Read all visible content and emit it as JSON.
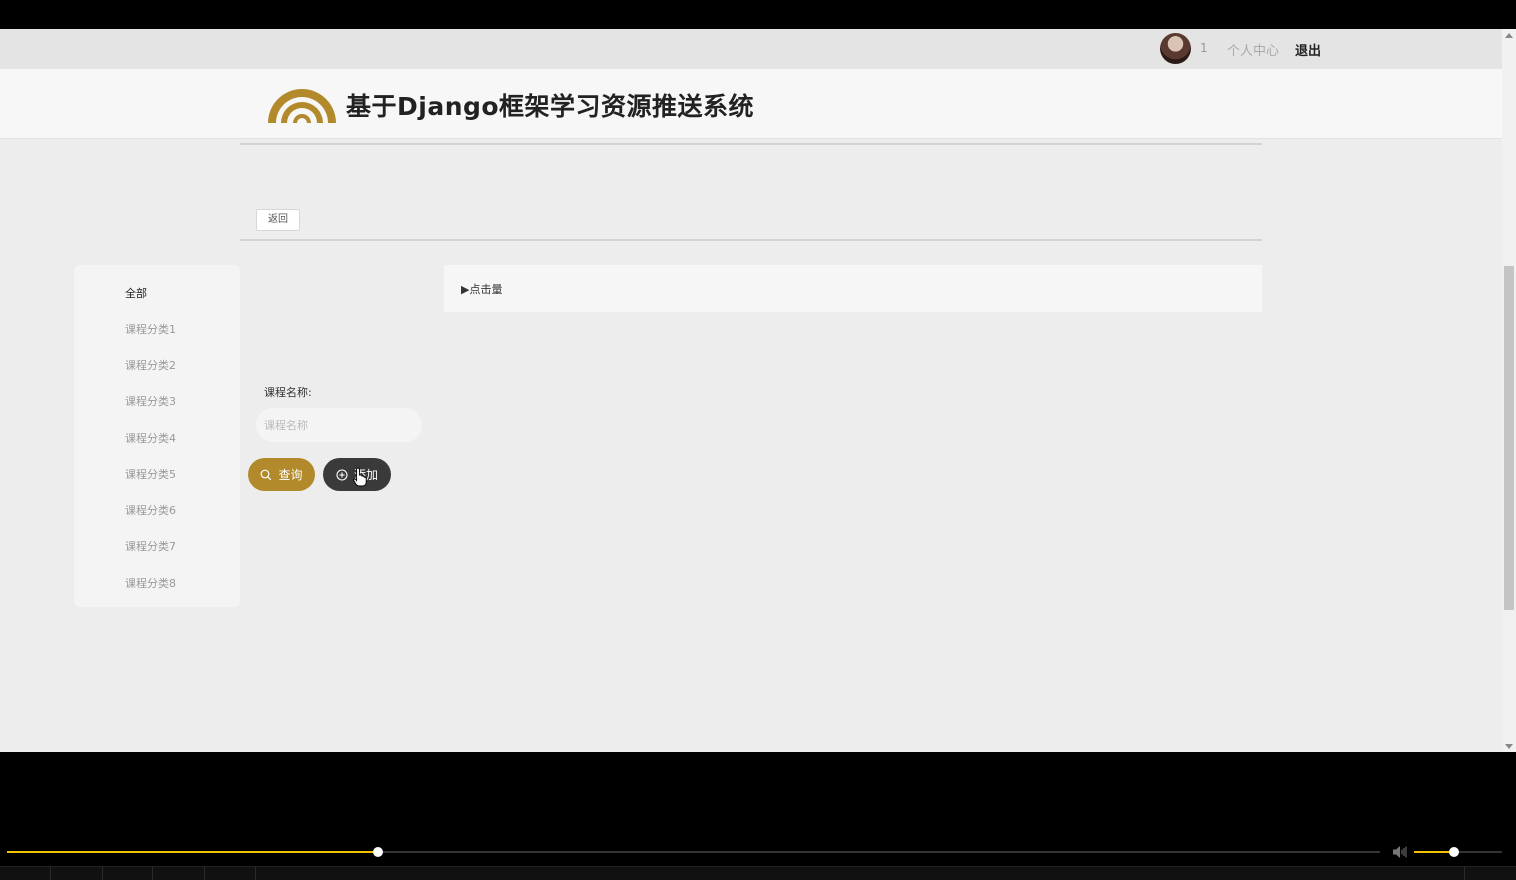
{
  "topbar": {
    "username": "1",
    "user_center": "个人中心",
    "logout": "退出"
  },
  "header": {
    "site_title": "基于Django框架学习资源推送系统",
    "brand_color": "#b28a2c"
  },
  "back_button": "返回",
  "sidebar": {
    "items": [
      {
        "label": "全部",
        "active": true
      },
      {
        "label": "课程分类1"
      },
      {
        "label": "课程分类2"
      },
      {
        "label": "课程分类3"
      },
      {
        "label": "课程分类4"
      },
      {
        "label": "课程分类5"
      },
      {
        "label": "课程分类6"
      },
      {
        "label": "课程分类7"
      },
      {
        "label": "课程分类8"
      }
    ]
  },
  "sort": {
    "label": "点击量",
    "icon": "triangle-right-icon"
  },
  "search": {
    "label": "课程名称:",
    "placeholder": "课程名称",
    "value": "",
    "query_button": "查询",
    "add_button": "添加",
    "query_color": "#b28a2c",
    "add_color": "#3a3a3a"
  },
  "player": {
    "progress": 0.27,
    "volume": 0.45,
    "accent_color": "#f2c200"
  }
}
